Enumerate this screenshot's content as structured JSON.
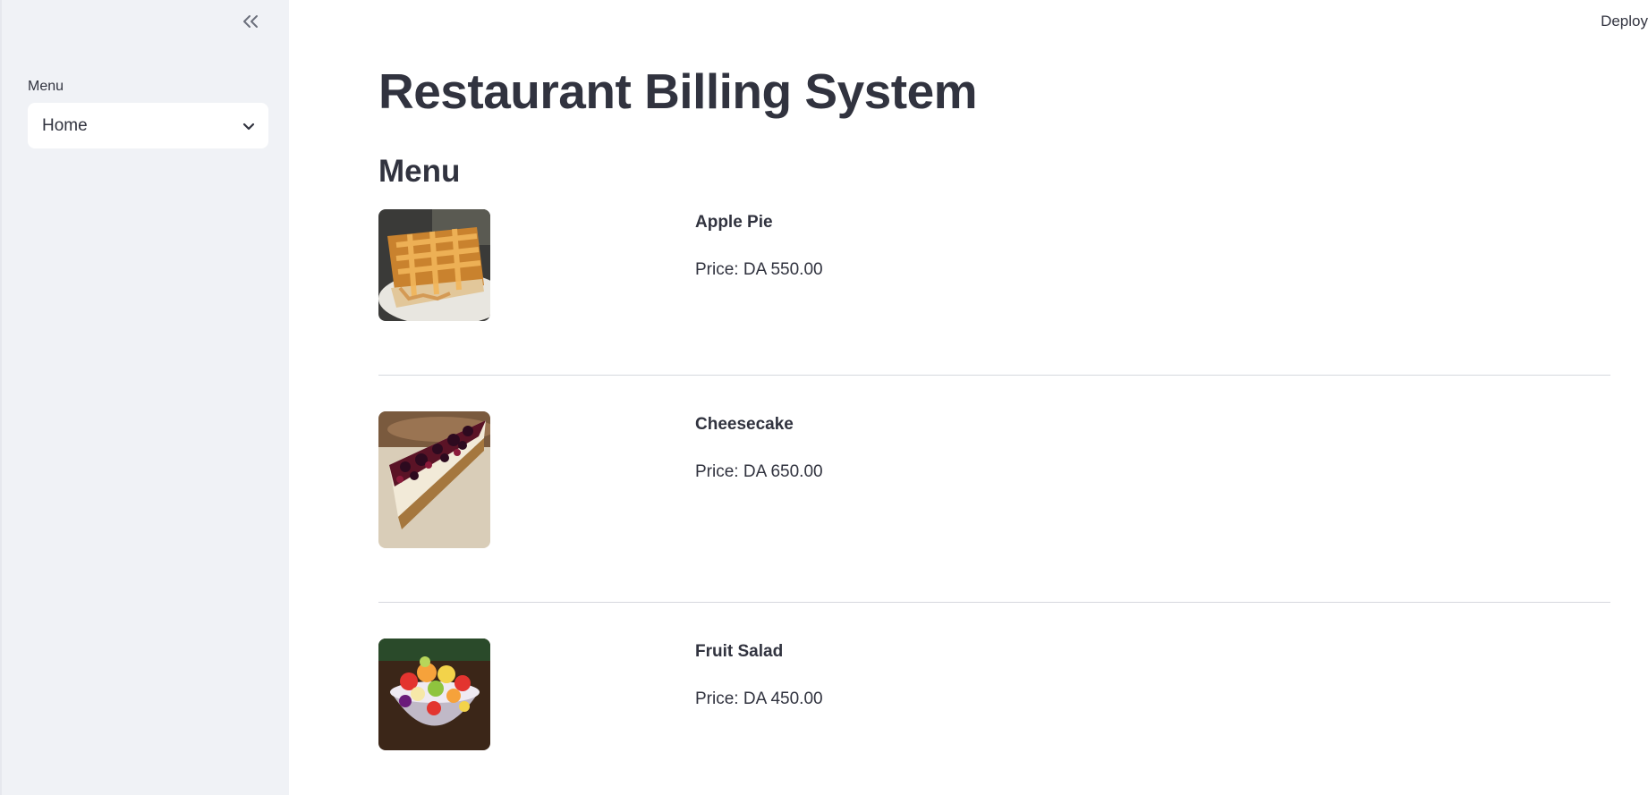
{
  "sidebar": {
    "collapse_icon": "double-chevron-left-icon",
    "menu_label": "Menu",
    "select": {
      "value": "Home",
      "icon": "chevron-down-icon"
    }
  },
  "header": {
    "deploy_label": "Deploy"
  },
  "main": {
    "title": "Restaurant Billing System",
    "section_title": "Menu",
    "items": [
      {
        "name": "Apple Pie",
        "price": "Price: DA 550.00"
      },
      {
        "name": "Cheesecake",
        "price": "Price: DA 650.00"
      },
      {
        "name": "Fruit Salad",
        "price": "Price: DA 450.00"
      }
    ]
  },
  "colors": {
    "sidebar_bg": "#f0f2f6",
    "text": "#31333f",
    "divider": "#d6d8de"
  }
}
